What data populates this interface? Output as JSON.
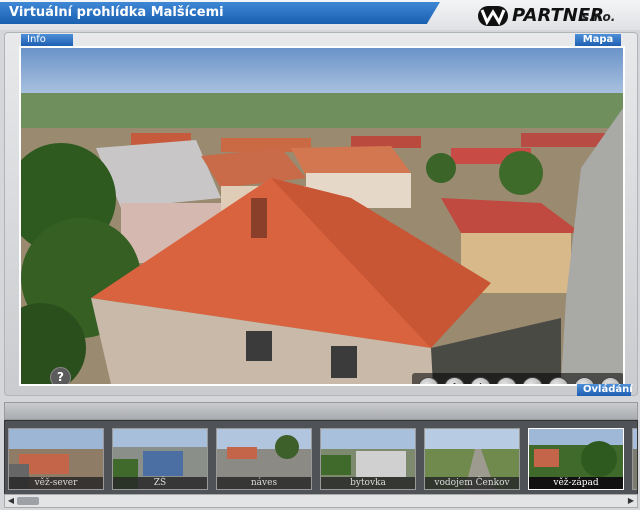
{
  "header": {
    "title": "Virtuální prohlídka Malšícemi",
    "logo_text": "PARTNER",
    "logo_suffix": "s.r.o."
  },
  "viewer": {
    "info_tab": "Info",
    "map_tab": "Mapa",
    "controls_tab": "Ovládání",
    "help_label": "?",
    "controls": [
      {
        "name": "play",
        "glyph": "▶"
      },
      {
        "name": "up",
        "glyph": "↑"
      },
      {
        "name": "down",
        "glyph": "↓"
      },
      {
        "name": "left",
        "glyph": "←"
      },
      {
        "name": "right",
        "glyph": "→"
      },
      {
        "name": "zoom-in",
        "glyph": "+"
      },
      {
        "name": "zoom-out",
        "glyph": "−"
      },
      {
        "name": "fullscreen",
        "glyph": "▣"
      }
    ]
  },
  "thumbnails": [
    {
      "label": "věž-sever",
      "active": false
    },
    {
      "label": "ZŠ",
      "active": false
    },
    {
      "label": "náves",
      "active": false
    },
    {
      "label": "bytovka",
      "active": false
    },
    {
      "label": "vodojem Čenkov",
      "active": false
    },
    {
      "label": "věž-západ",
      "active": true
    }
  ],
  "scroll": {
    "left_glyph": "◀",
    "right_glyph": "▶"
  },
  "colors": {
    "accent": "#1f5fb2",
    "roof": "#d9623f"
  }
}
